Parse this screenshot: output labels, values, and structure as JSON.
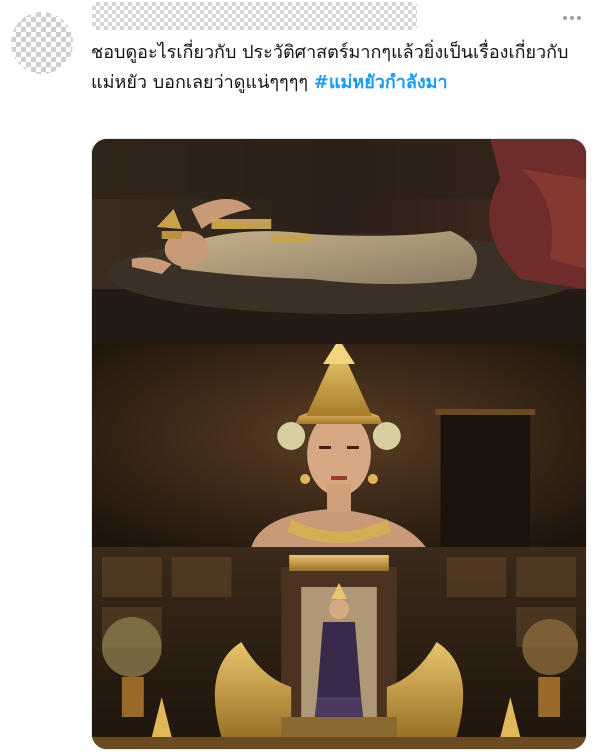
{
  "tweet": {
    "text_main": "ชอบดูอะไรเกี่ยวกับ ประวัติศาสตร์มากๆแล้วยิ่งเป็นเรื่องเกี่ยวกับแม่หยัว บอกเลยว่าดูแน่ๆๆๆๆ ",
    "hashtag": "#แม่หยัวกำลังมา"
  },
  "icons": {
    "more": "more-horizontal-icon",
    "avatar": "avatar-redacted"
  },
  "colors": {
    "hashtag": "#1d9bf0",
    "text": "#0f1419",
    "gold": "#c9a24a"
  }
}
